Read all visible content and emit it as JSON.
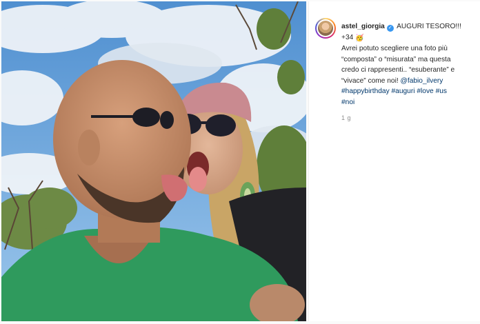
{
  "post": {
    "username": "astel_giorgia",
    "headline": "AUGURI TESORO!!!",
    "age_tag": "+34",
    "caption_lines": [
      "Avrei potuto scegliere una foto più",
      "“composta” o “misurata” ma questa",
      "credo ci rappresenti.. “esuberante” e",
      "“vivace” come noi!"
    ],
    "mention": "@fabio_ilvery",
    "hashtags_line1": [
      "#happybirthday",
      "#auguri",
      "#love",
      "#us"
    ],
    "hashtags_line2": [
      "#noi"
    ],
    "timestamp": "1 g"
  },
  "icons": {
    "verified": "verified-badge-icon",
    "party_hat": "party-hat-emoji-icon",
    "avatar": "user-avatar"
  },
  "colors": {
    "link": "#00376b",
    "text": "#262626",
    "muted": "#8e8e8e",
    "verified": "#3897f0"
  }
}
